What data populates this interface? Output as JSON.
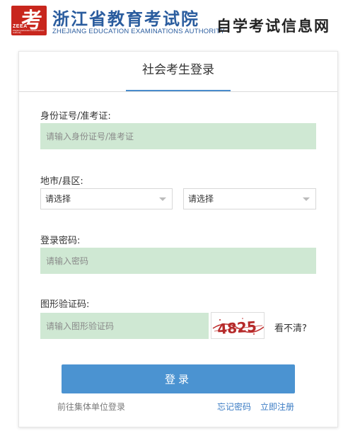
{
  "header": {
    "logo_char": "考",
    "logo_abbr": "ZEEA",
    "logo_small": "Zhejiang Education Examinations Authority",
    "org_name": "浙江省教育考试院",
    "org_name_en": "ZHEJIANG EDUCATION EXAMINATIONS AUTHORITY",
    "site_name": "自学考试信息网"
  },
  "login": {
    "tab_label": "社会考生登录",
    "id_label": "身份证号/准考证:",
    "id_placeholder": "请输入身份证号/准考证",
    "region_label": "地市/县区:",
    "city_select": "请选择",
    "county_select": "请选择",
    "password_label": "登录密码:",
    "password_placeholder": "请输入密码",
    "captcha_label": "图形验证码:",
    "captcha_placeholder": "请输入图形验证码",
    "captcha_text": "4825",
    "refresh_label": "看不清?",
    "submit_label": "登录",
    "group_login_link": "前往集体单位登录",
    "forgot_password_link": "忘记密码",
    "register_link": "立即注册"
  },
  "colors": {
    "brand_blue": "#2a5c9e",
    "logo_red": "#c8261d",
    "input_bg": "#cfe8d3",
    "button_blue": "#4b93d1",
    "link_blue": "#3b7cc4"
  }
}
